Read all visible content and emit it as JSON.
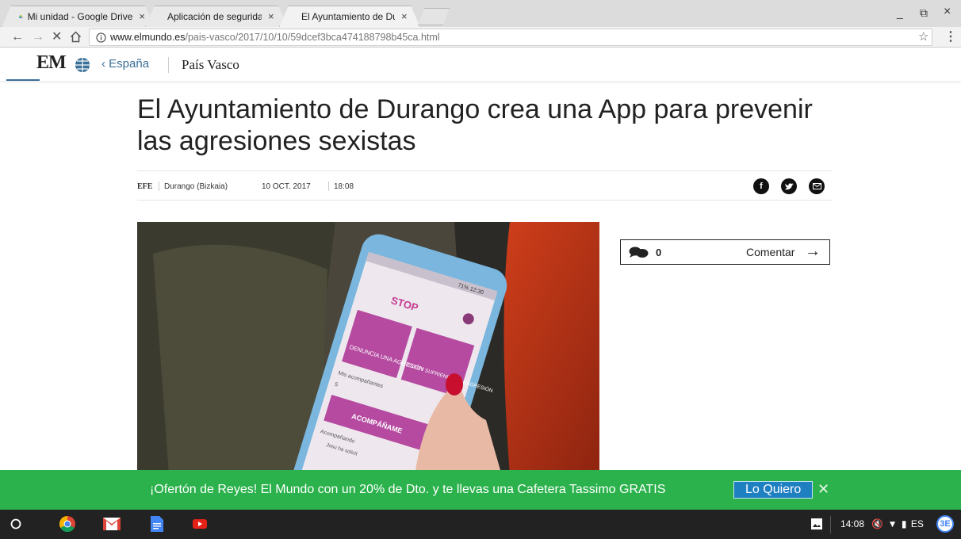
{
  "tabs": [
    {
      "title": "Mi unidad - Google Drive",
      "icon": "google-drive-icon"
    },
    {
      "title": "Aplicación de seguridad",
      "icon": "google-docs-icon"
    },
    {
      "title": "El Ayuntamiento de Dur",
      "icon": "loading-spinner-icon"
    }
  ],
  "window": {
    "minimize": "_",
    "restore": "⧉",
    "close": "×"
  },
  "toolbar": {
    "url_host": "www.elmundo.es",
    "url_path": "/pais-vasco/2017/10/10/59dcef3bca474188798b45ca.html"
  },
  "site": {
    "logo": "EM",
    "breadcrumb": "España",
    "section": "País Vasco",
    "brand_color": "#3a6f98"
  },
  "article": {
    "headline": "El Ayuntamiento de Durango crea una App para prevenir las agresiones sexistas",
    "agency": "EFE",
    "place": "Durango (Bizkaia)",
    "date": "10 OCT. 2017",
    "time": "18:08",
    "share": [
      "facebook-icon",
      "twitter-icon",
      "email-icon"
    ]
  },
  "photo": {
    "status_bar": "71% 12:30",
    "app_logo": "STOP",
    "tile1": "DENUNCIA UNA AGRESIÓN",
    "tile2": "ESTOY SUFRIENDO UNA AGRESIÓN",
    "companions_label": "Mis acompañantes",
    "companions_count": "5",
    "accompany_btn": "ACOMPÁÑAME",
    "accompanying_label": "Acompañando",
    "request_text": "Josu ha solicit"
  },
  "comments": {
    "count": "0",
    "label": "Comentar"
  },
  "promo": {
    "text": "¡Ofertón de Reyes! El Mundo con un 20% de Dto. y te llevas una Cafetera Tassimo GRATIS",
    "button": "Lo Quiero",
    "color": "#2bb24c"
  },
  "shelf": {
    "apps": [
      "launcher-icon",
      "chrome-icon",
      "gmail-icon",
      "docs-icon",
      "youtube-icon"
    ],
    "time": "14:08",
    "lang": "ES"
  }
}
